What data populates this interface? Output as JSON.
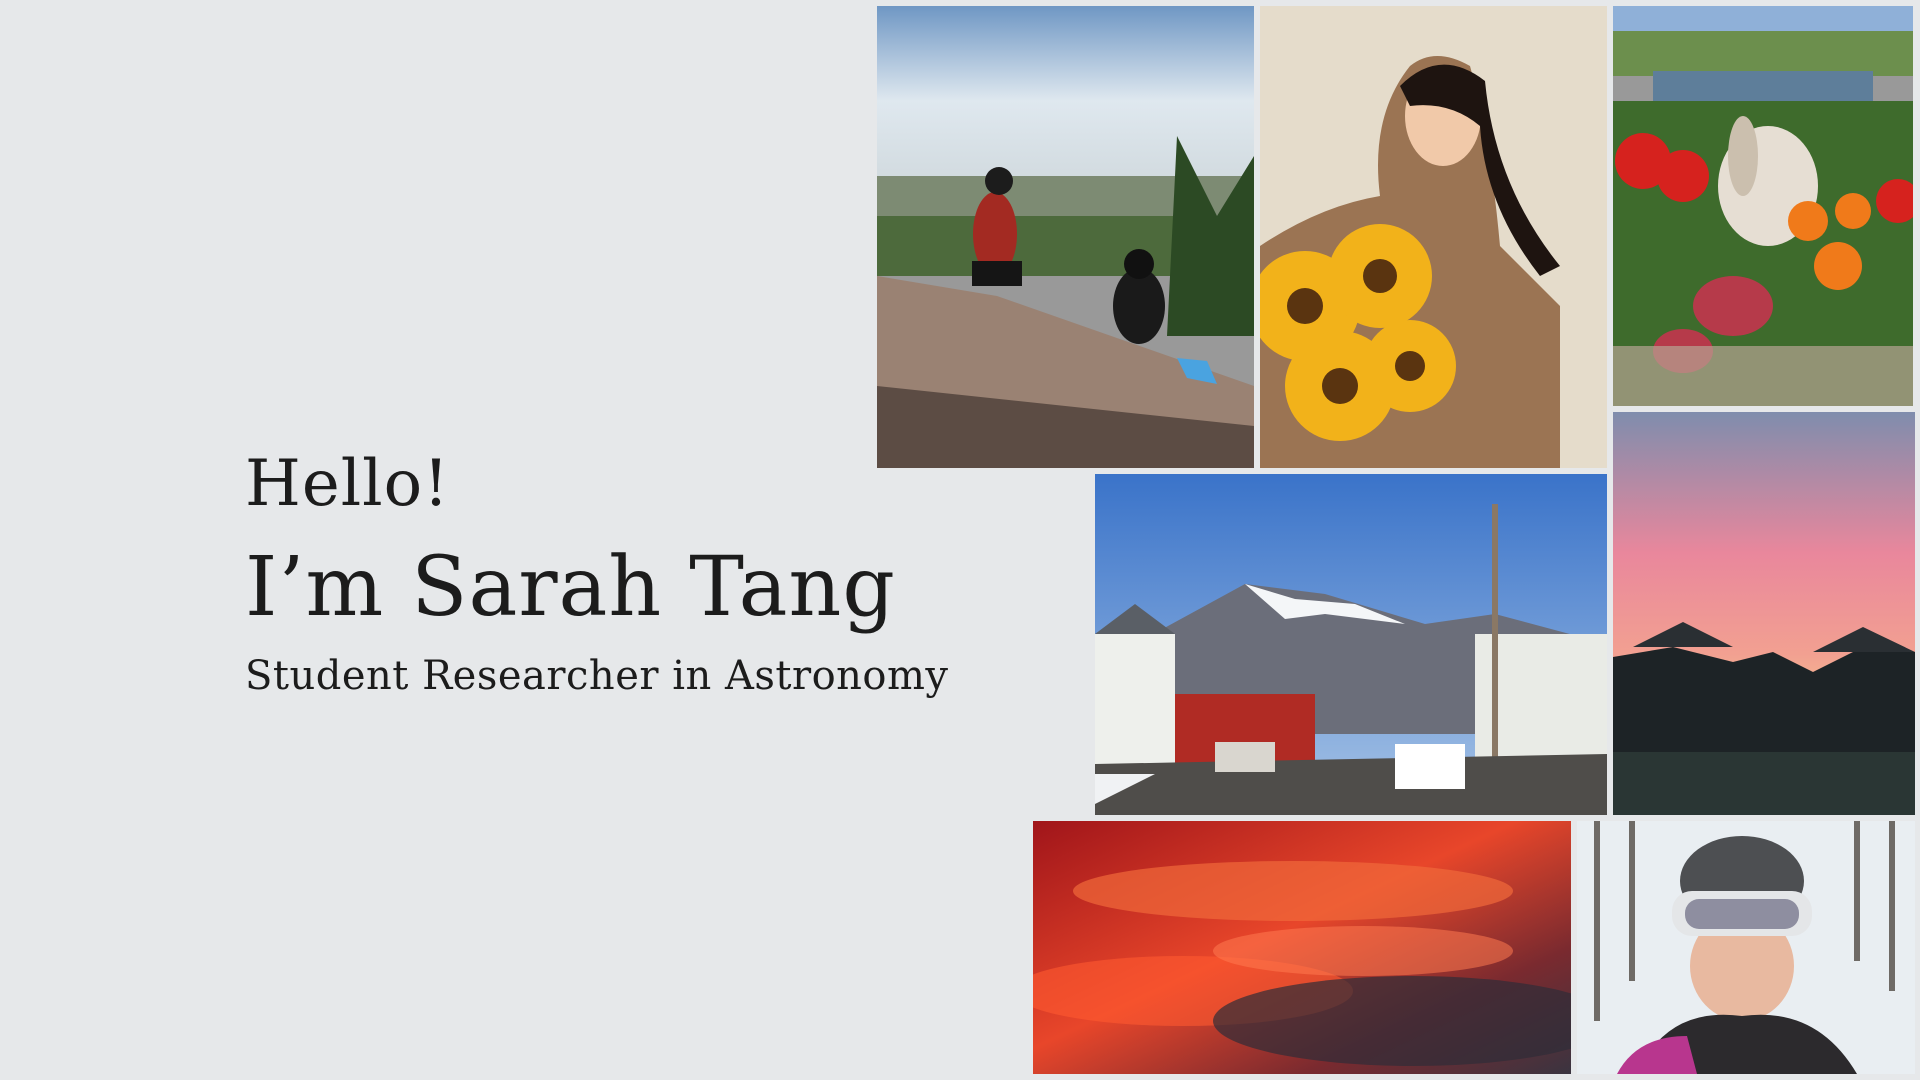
{
  "intro": {
    "greeting": "Hello!",
    "name": "I’m Sarah Tang",
    "role": "Student Researcher in Astronomy"
  },
  "photos": [
    {
      "id": "hike",
      "subject": "two people sitting on a rock overlooking a valley"
    },
    {
      "id": "sunflower",
      "subject": "smiling person holding sunflowers"
    },
    {
      "id": "bunny",
      "subject": "rabbit among red and orange flowers"
    },
    {
      "id": "town",
      "subject": "mountain town street with snowy peaks"
    },
    {
      "id": "sunset",
      "subject": "pink sunset sky over houses"
    },
    {
      "id": "clouds",
      "subject": "fiery red sunset clouds"
    },
    {
      "id": "ski",
      "subject": "skier selfie with goggles in snowy forest"
    }
  ],
  "colors": {
    "background": "#e6e8ea",
    "text": "#1c1c1c"
  }
}
